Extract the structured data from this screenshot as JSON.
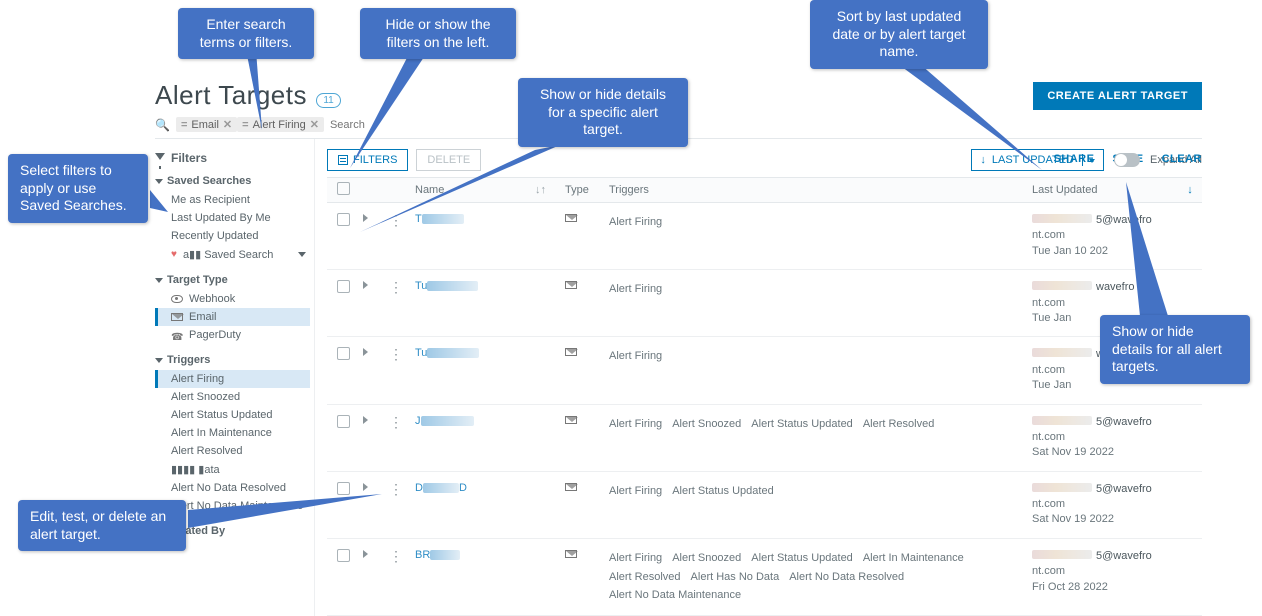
{
  "callouts": {
    "search": "Enter search terms or filters.",
    "hide_filters": "Hide or show  the filters on the left.",
    "row_expand": "Show or hide details for a specific alert target.",
    "sort": "Sort by last updated date or by alert target name.",
    "select_filters": "Select filters to apply or use Saved Searches.",
    "expand_all": "Show or hide details for all alert targets.",
    "kebab": "Edit, test, or delete an alert target."
  },
  "header": {
    "title": "Alert Targets",
    "badge_count": "11",
    "create_button": "CREATE ALERT TARGET",
    "share": "SHARE",
    "save": "SAVE",
    "clear": "CLEAR"
  },
  "search": {
    "placeholder": "Search",
    "chips": [
      {
        "op": "=",
        "label": "Email"
      },
      {
        "op": "=",
        "label": "Alert Firing"
      }
    ]
  },
  "sidebar": {
    "heading": "Filters",
    "groups": {
      "saved": {
        "label": "Saved Searches",
        "items": [
          "Me as Recipient",
          "Last Updated By Me",
          "Recently Updated",
          "a▮▮ Saved Search"
        ]
      },
      "target_type": {
        "label": "Target Type",
        "items": [
          "Webhook",
          "Email",
          "PagerDuty"
        ],
        "selected_index": 1
      },
      "triggers": {
        "label": "Triggers",
        "items": [
          "Alert Firing",
          "Alert Snoozed",
          "Alert Status Updated",
          "Alert In Maintenance",
          "Alert Resolved",
          "▮▮▮▮ ▮ata",
          "Alert No Data Resolved",
          "Alert No Data Maintenance"
        ],
        "selected_index": 0
      },
      "updated_by": {
        "label": "Updated By"
      }
    }
  },
  "toolbar": {
    "filters_button": "FILTERS",
    "delete_button": "DELETE",
    "sort_label": "LAST UPDATED",
    "expand_all_label": "Expand All"
  },
  "columns": {
    "name": "Name",
    "type": "Type",
    "triggers": "Triggers",
    "updated": "Last Updated"
  },
  "rows": [
    {
      "name_prefix": "T",
      "triggers": [
        "Alert Firing"
      ],
      "email_suffix": "5@wavefro",
      "domain": "nt.com",
      "date": "Tue Jan 10 202"
    },
    {
      "name_prefix": "Tu",
      "triggers": [
        "Alert Firing"
      ],
      "email_suffix": "wavefro",
      "domain": "nt.com",
      "date": "Tue Jan"
    },
    {
      "name_prefix": "Tu",
      "triggers": [
        "Alert Firing"
      ],
      "email_suffix": "wavefro",
      "domain": "nt.com",
      "date": "Tue Jan"
    },
    {
      "name_prefix": "J",
      "triggers": [
        "Alert Firing",
        "Alert Snoozed",
        "Alert Status Updated",
        "Alert Resolved"
      ],
      "email_suffix": "5@wavefro",
      "domain": "nt.com",
      "date": "Sat Nov 19 2022"
    },
    {
      "name_prefix": "D",
      "name_mid": "D",
      "triggers": [
        "Alert Firing",
        "Alert Status Updated"
      ],
      "email_suffix": "5@wavefro",
      "domain": "nt.com",
      "date": "Sat Nov 19 2022"
    },
    {
      "name_prefix": "BR",
      "triggers": [
        "Alert Firing",
        "Alert Snoozed",
        "Alert Status Updated",
        "Alert In Maintenance",
        "Alert Resolved",
        "Alert Has No Data",
        "Alert No Data Resolved",
        "Alert No Data Maintenance"
      ],
      "email_suffix": "5@wavefro",
      "domain": "nt.com",
      "date": "Fri Oct 28 2022"
    }
  ]
}
